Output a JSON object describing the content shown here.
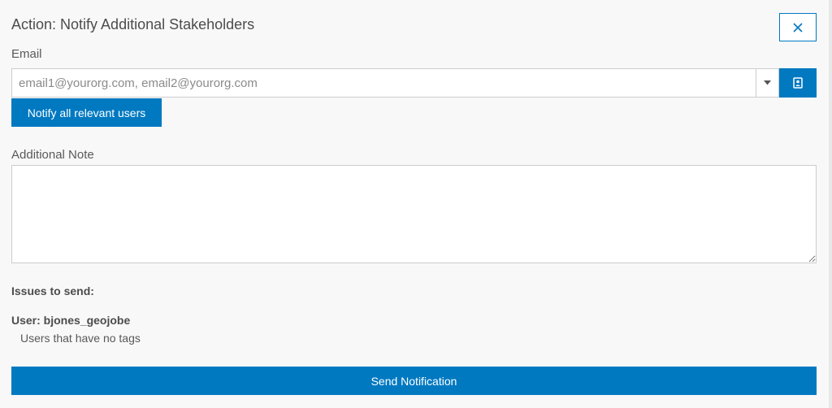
{
  "dialog": {
    "title": "Action: Notify Additional Stakeholders",
    "close_icon": "close-icon"
  },
  "email": {
    "label": "Email",
    "placeholder": "email1@yourorg.com, email2@yourorg.com",
    "value": "",
    "dropdown_icon": "caret-down-icon",
    "contacts_icon": "contact-card-icon"
  },
  "notify_all": {
    "label": "Notify all relevant users"
  },
  "note": {
    "label": "Additional Note",
    "value": ""
  },
  "issues": {
    "heading": "Issues to send:",
    "items": [
      {
        "user_label": "User: bjones_geojobe",
        "detail": "Users that have no tags"
      }
    ]
  },
  "send": {
    "label": "Send Notification"
  },
  "colors": {
    "accent": "#0079c1",
    "background": "#f8f8f8",
    "text": "#4c4c4c"
  }
}
